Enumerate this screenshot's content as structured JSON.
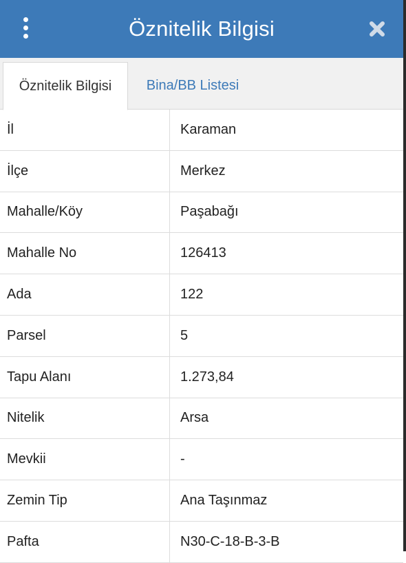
{
  "header": {
    "title": "Öznitelik Bilgisi",
    "menu_icon": "more-vertical-icon",
    "close_icon": "close-icon",
    "bg_color": "#3d7ab8"
  },
  "tabs": [
    {
      "label": "Öznitelik Bilgisi",
      "active": true
    },
    {
      "label": "Bina/BB Listesi",
      "active": false
    }
  ],
  "attributes": {
    "rows": [
      {
        "label": "İl",
        "value": "Karaman"
      },
      {
        "label": "İlçe",
        "value": "Merkez"
      },
      {
        "label": "Mahalle/Köy",
        "value": "Paşabağı"
      },
      {
        "label": "Mahalle No",
        "value": "126413"
      },
      {
        "label": "Ada",
        "value": "122"
      },
      {
        "label": "Parsel",
        "value": "5"
      },
      {
        "label": "Tapu Alanı",
        "value": "1.273,84"
      },
      {
        "label": "Nitelik",
        "value": "Arsa"
      },
      {
        "label": "Mevkii",
        "value": "-"
      },
      {
        "label": "Zemin Tip",
        "value": "Ana Taşınmaz"
      },
      {
        "label": "Pafta",
        "value": "N30-C-18-B-3-B"
      }
    ]
  }
}
